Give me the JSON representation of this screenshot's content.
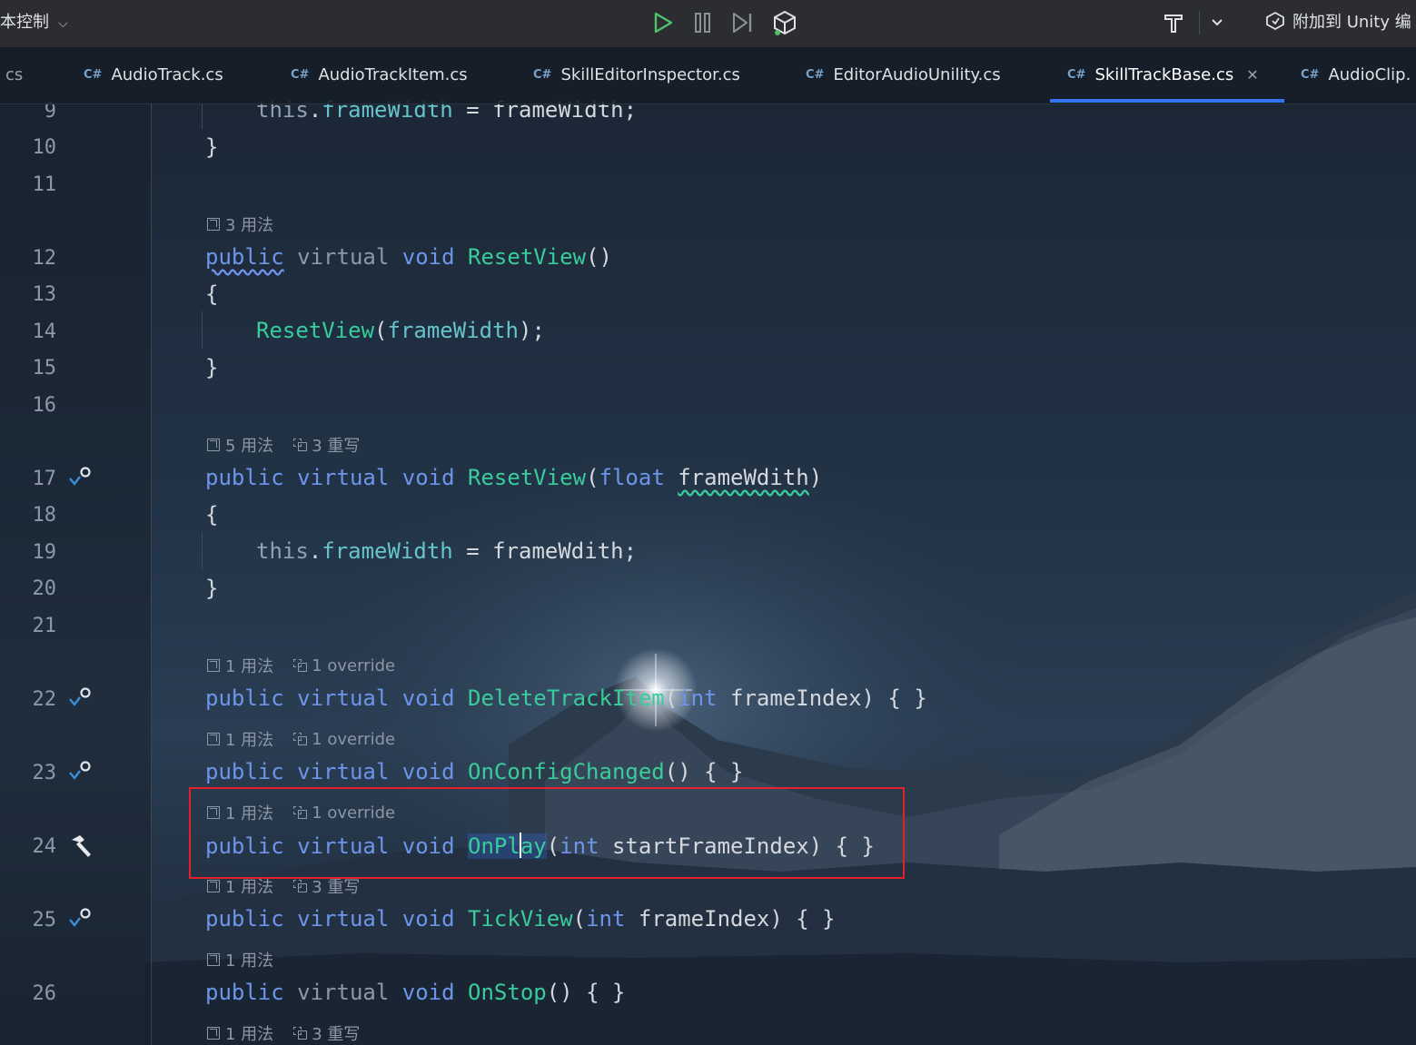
{
  "toolbar": {
    "vcs_label": "本控制",
    "attach_label": "附加到 Unity 编"
  },
  "tabs": [
    {
      "label": "cs",
      "badge": ""
    },
    {
      "label": "AudioTrack.cs",
      "badge": "C#"
    },
    {
      "label": "AudioTrackItem.cs",
      "badge": "C#"
    },
    {
      "label": "SkillEditorInspector.cs",
      "badge": "C#"
    },
    {
      "label": "EditorAudioUnility.cs",
      "badge": "C#"
    },
    {
      "label": "SkillTrackBase.cs",
      "badge": "C#",
      "active": true
    },
    {
      "label": "AudioClip.",
      "badge": "C#"
    }
  ],
  "line_numbers": [
    "9",
    "10",
    "11",
    "12",
    "13",
    "14",
    "15",
    "16",
    "17",
    "18",
    "19",
    "20",
    "21",
    "22",
    "23",
    "24",
    "25",
    "26"
  ],
  "hints": {
    "h12": {
      "usages": "3 用法"
    },
    "h17": {
      "usages": "5 用法",
      "overrides": "3 重写"
    },
    "h22": {
      "usages": "1 用法",
      "overrides": "1 override"
    },
    "h23": {
      "usages": "1 用法",
      "overrides": "1 override"
    },
    "h24": {
      "usages": "1 用法",
      "overrides": "1 override"
    },
    "h25": {
      "usages": "1 用法",
      "overrides": "3 重写"
    },
    "h26": {
      "usages": "1 用法"
    },
    "h27": {
      "usages": "1 用法",
      "overrides": "3 重写"
    }
  },
  "code": {
    "t_this": "this",
    "t_dot": ".",
    "t_frameWidth": "frameWidth",
    "t_eq": " = ",
    "t_frameWidth_semi": "frameWidth;",
    "t_rbrace": "}",
    "t_lbrace": "{",
    "t_public": "public",
    "t_virtual": "virtual",
    "t_void": "void",
    "t_int": "int",
    "t_float": "float",
    "t_ResetView": "ResetView",
    "t_parens": "()",
    "t_lparen": "(",
    "t_rparen": ")",
    "t_semi_close": ");",
    "t_frameWdith": "frameWdith",
    "t_frameWdith_semi": "frameWdith;",
    "t_DeleteTrackItem": "DeleteTrackItem",
    "t_frameIndex": "frameIndex",
    "t_empty_body": ") { }",
    "t_OnConfigChanged": "OnConfigChanged",
    "t_parens_body": "() { }",
    "t_OnPl": "OnPl",
    "t_ay": "ay",
    "t_startFrameIndex": "startFrameIndex",
    "t_TickView": "TickView",
    "t_OnStop": "OnStop"
  }
}
